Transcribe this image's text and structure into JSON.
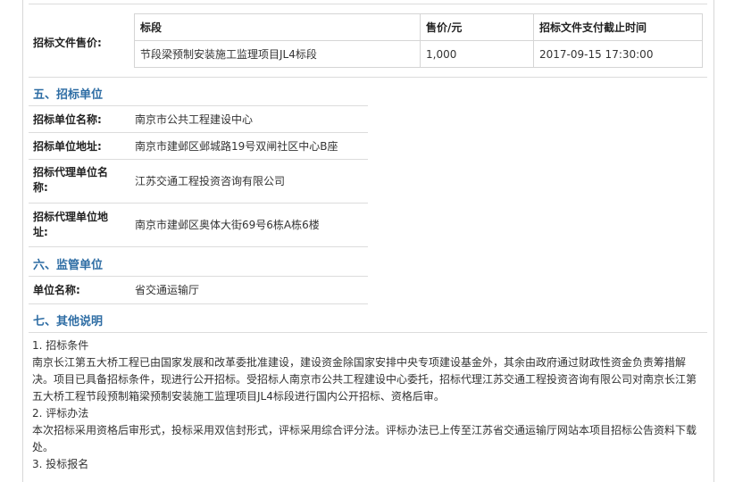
{
  "price_section": {
    "label": "招标文件售价:",
    "columns": [
      "标段",
      "售价/元",
      "招标文件支付截止时间"
    ],
    "rows": [
      [
        "节段梁预制安装施工监理项目JL4标段",
        "1,000",
        "2017-09-15 17:30:00"
      ]
    ]
  },
  "section5": {
    "title": "五、招标单位",
    "fields": [
      {
        "label": "招标单位名称:",
        "value": "南京市公共工程建设中心"
      },
      {
        "label": "招标单位地址:",
        "value": "南京市建邺区邺城路19号双闸社区中心B座"
      },
      {
        "label": "招标代理单位名称:",
        "value": "江苏交通工程投资咨询有限公司"
      },
      {
        "label": "招标代理单位地址:",
        "value": "南京市建邺区奥体大街69号6栋A栋6楼"
      }
    ]
  },
  "section6": {
    "title": "六、监管单位",
    "fields": [
      {
        "label": "单位名称:",
        "value": "省交通运输厅"
      }
    ]
  },
  "section7": {
    "title": "七、其他说明",
    "items": [
      {
        "heading": "1. 招标条件",
        "lines": [
          "南京长江第五大桥工程已由国家发展和改革委批准建设，建设资金除国家安排中央专项建设基金外，其余由政府通过财政性资金负责筹措解",
          "决。项目已具备招标条件，现进行公开招标。受招标人南京市公共工程建设中心委托，招标代理江苏交通工程投资咨询有限公司对南京长江第",
          "五大桥工程节段预制箱梁预制安装施工监理项目JL4标段进行国内公开招标、资格后审。"
        ]
      },
      {
        "heading": "2. 评标办法",
        "lines": [
          "本次招标采用资格后审形式，投标采用双信封形式，评标采用综合评分法。评标办法已上传至江苏省交通运输厅网站本项目招标公告资料下载",
          "处。"
        ]
      },
      {
        "heading": "3. 投标报名",
        "lines": []
      }
    ]
  }
}
